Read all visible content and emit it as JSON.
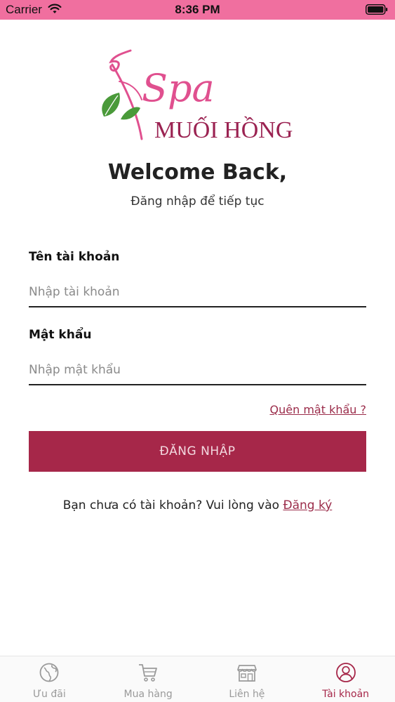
{
  "status_bar": {
    "carrier": "Carrier",
    "time": "8:36 PM"
  },
  "logo": {
    "brand_script": "Spa",
    "brand_name": "MUỐI HỒNG",
    "colors": {
      "pink": "#e0508f",
      "wine": "#9b2352",
      "leaf": "#4a9a3a"
    }
  },
  "header": {
    "title": "Welcome Back,",
    "subtitle": "Đăng nhập để tiếp tục"
  },
  "form": {
    "username_label": "Tên tài khoản",
    "username_placeholder": "Nhập tài khoản",
    "username_value": "",
    "password_label": "Mật khẩu",
    "password_placeholder": "Nhập mật khẩu",
    "password_value": "",
    "forgot_label": "Quên mật khẩu ?",
    "login_label": "ĐĂNG NHẬP"
  },
  "register": {
    "prompt": "Bạn chưa có tài khoản? Vui lòng vào ",
    "link_label": "Đăng ký"
  },
  "tabs": [
    {
      "label": "Ưu đãi",
      "icon": "globe-icon",
      "active": false
    },
    {
      "label": "Mua hàng",
      "icon": "cart-icon",
      "active": false
    },
    {
      "label": "Liên hệ",
      "icon": "store-icon",
      "active": false
    },
    {
      "label": "Tài khoản",
      "icon": "user-icon",
      "active": true
    }
  ],
  "theme": {
    "accent": "#a62749",
    "status_bar": "#f06f9f",
    "tab_inactive": "#9a9a9a"
  }
}
